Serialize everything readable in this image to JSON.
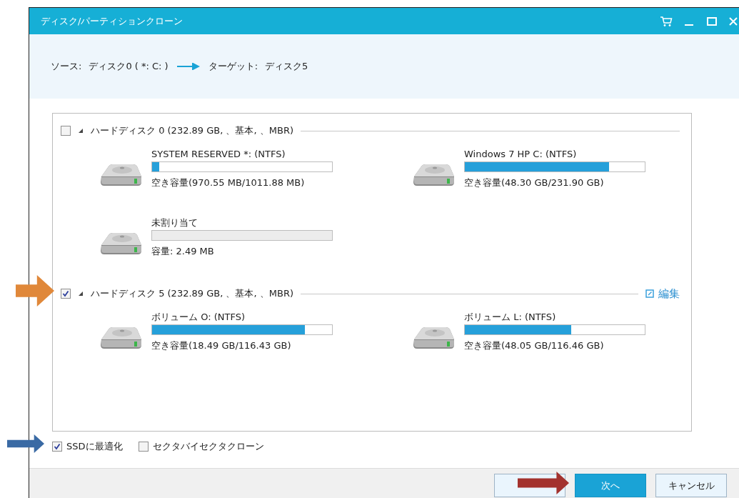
{
  "window": {
    "title": "ディスク/パーティションクローン"
  },
  "route": {
    "source_label": "ソース:",
    "source": "ディスク0 ( *: C: )",
    "target_label": "ターゲット:",
    "target": "ディスク5"
  },
  "disks": [
    {
      "label": "ハードディスク 0 (232.89 GB, 、基本, 、MBR)",
      "checked": false,
      "partitions": [
        {
          "kind": "volume",
          "name": "SYSTEM RESERVED *: (NTFS)",
          "level": 0.04,
          "info": "空き容量(970.55 MB/1011.88 MB)"
        },
        {
          "kind": "volume",
          "name": "Windows 7 HP C: (NTFS)",
          "level": 0.8,
          "info": "空き容量(48.30 GB/231.90 GB)"
        },
        {
          "kind": "unallocated",
          "name": "未割り当て",
          "info": "容量: 2.49 MB"
        }
      ]
    },
    {
      "label": "ハードディスク 5 (232.89 GB, 、基本, 、MBR)",
      "checked": true,
      "edit": "編集",
      "partitions": [
        {
          "kind": "volume",
          "name": "ボリューム O: (NTFS)",
          "level": 0.85,
          "info": "空き容量(18.49 GB/116.43 GB)"
        },
        {
          "kind": "volume",
          "name": "ボリューム L: (NTFS)",
          "level": 0.59,
          "info": "空き容量(48.05 GB/116.46 GB)"
        }
      ]
    }
  ],
  "options": [
    {
      "label": "SSDに最適化",
      "checked": true
    },
    {
      "label": "セクタバイセクタクローン",
      "checked": false
    }
  ],
  "buttons": [
    {
      "kind": "secondary"
    },
    {
      "label": "次へ",
      "kind": "primary"
    },
    {
      "label": "キャンセル",
      "kind": "secondary"
    }
  ]
}
